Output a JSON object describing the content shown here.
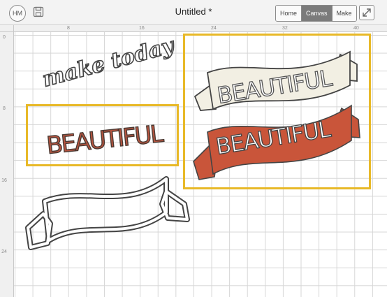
{
  "header": {
    "avatar_initials": "HM",
    "title": "Untitled *",
    "modes": [
      {
        "label": "Home",
        "active": false
      },
      {
        "label": "Canvas",
        "active": true
      },
      {
        "label": "Make",
        "active": false
      }
    ],
    "save_icon": "save-icon",
    "fullscreen_icon": "expand-icon"
  },
  "rulers": {
    "horizontal": [
      "8",
      "16",
      "24",
      "32",
      "40"
    ],
    "vertical": [
      "0",
      "8",
      "16",
      "24"
    ]
  },
  "canvas": {
    "script_text": "make today",
    "banner_text": "BEAUTIFUL",
    "colors": {
      "selection": "#e8b928",
      "rust": "#c9553a",
      "cream": "#f2efe3",
      "dark": "#444444",
      "text_fill": "#b8543f"
    }
  }
}
